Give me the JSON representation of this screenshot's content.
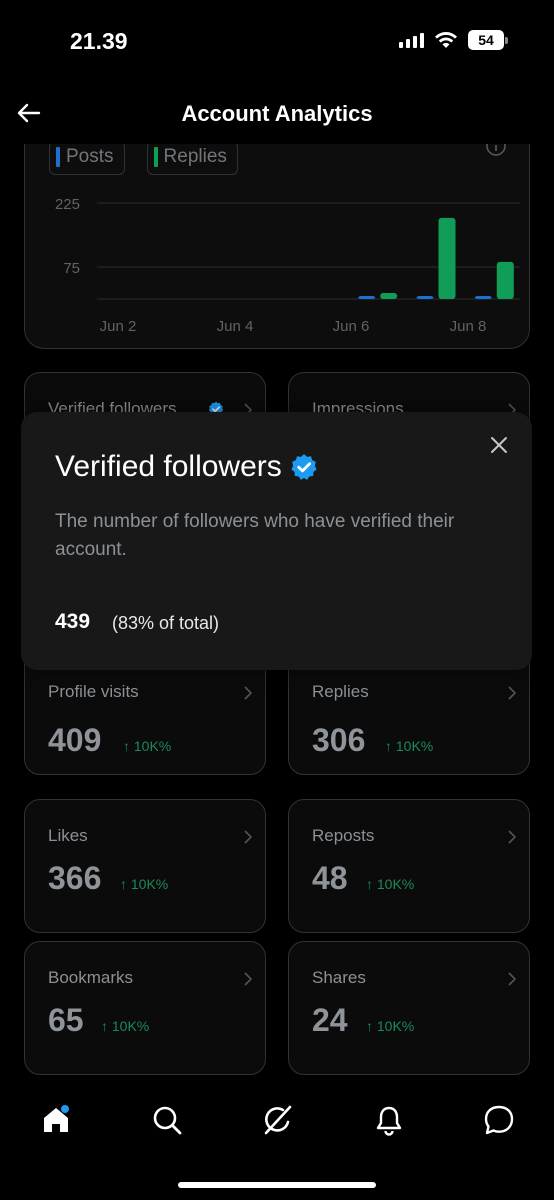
{
  "status_bar": {
    "time": "21.39",
    "battery": "54"
  },
  "header": {
    "title": "Account Analytics"
  },
  "chart": {
    "legend": [
      {
        "label": "Posts",
        "color": "#1d6fd1"
      },
      {
        "label": "Replies",
        "color": "#0f9d58"
      }
    ],
    "y_ticks": [
      "225",
      "75"
    ],
    "x_ticks": [
      "Jun 2",
      "Jun 4",
      "Jun 6",
      "Jun 8"
    ]
  },
  "chart_data": {
    "type": "bar",
    "categories": [
      "Jun 2",
      "Jun 3",
      "Jun 4",
      "Jun 5",
      "Jun 6",
      "Jun 7",
      "Jun 8"
    ],
    "series": [
      {
        "name": "Posts",
        "values": [
          0,
          0,
          0,
          0,
          2,
          6,
          5
        ]
      },
      {
        "name": "Replies",
        "values": [
          0,
          0,
          0,
          0,
          14,
          190,
          87
        ]
      }
    ],
    "y_ticks": [
      225,
      75
    ],
    "x_ticks": [
      "Jun 2",
      "Jun 4",
      "Jun 6",
      "Jun 8"
    ]
  },
  "stats": [
    {
      "label": "Verified followers"
    },
    {
      "label": "Impressions"
    },
    {
      "label": "Profile visits",
      "value": "409",
      "change": "↑ 10K%"
    },
    {
      "label": "Replies",
      "value": "306",
      "change": "↑ 10K%"
    },
    {
      "label": "Likes",
      "value": "366",
      "change": "↑ 10K%"
    },
    {
      "label": "Reposts",
      "value": "48",
      "change": "↑ 10K%"
    },
    {
      "label": "Bookmarks",
      "value": "65",
      "change": "↑ 10K%"
    },
    {
      "label": "Shares",
      "value": "24",
      "change": "↑ 10K%"
    }
  ],
  "popup": {
    "title": "Verified followers",
    "description": "The number of followers who have verified their account.",
    "value": "439",
    "percent": "(83% of total)"
  },
  "nav": {
    "items": [
      "home-icon",
      "search-icon",
      "grok-icon",
      "notifications-icon",
      "messages-icon"
    ],
    "accent": "#1d9bf0"
  }
}
